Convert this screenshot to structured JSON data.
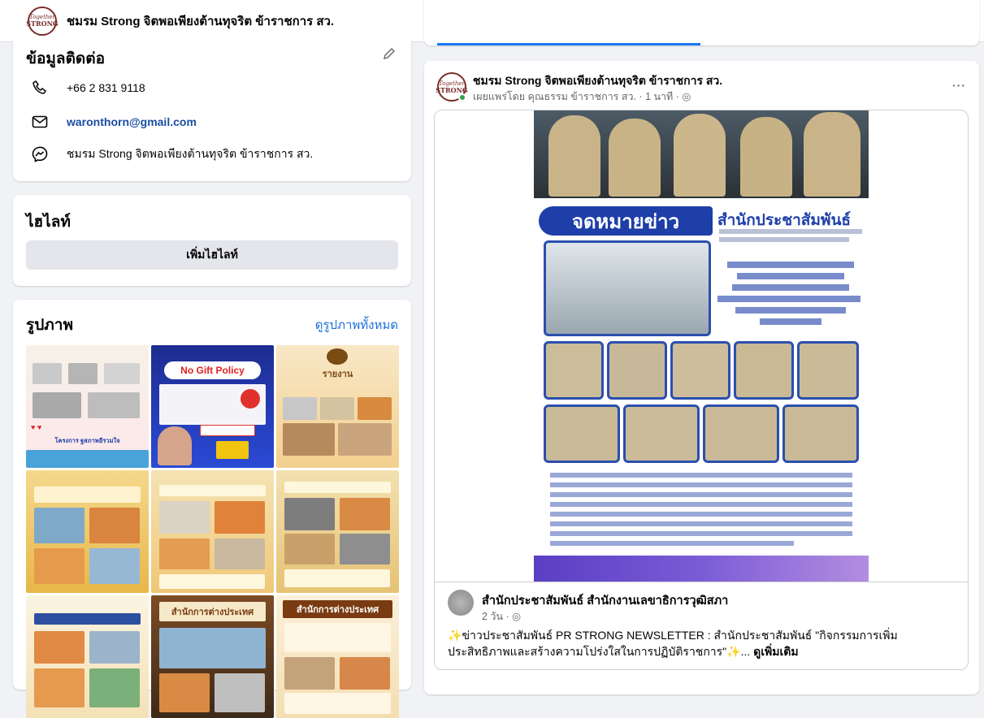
{
  "page": {
    "title": "ชมรม Strong จิตพอเพียงต้านทุจริต ข้าราชการ สว.",
    "logo_line1": "Together",
    "logo_line2": "STRONG",
    "more_icon": "more-horizontal-icon"
  },
  "contact": {
    "heading": "ข้อมูลติดต่อ",
    "phone": "+66 2 831 9118",
    "email": "waronthorn@gmail.com",
    "messenger": "ชมรม Strong จิตพอเพียงต้านทุจริต ข้าราชการ สว."
  },
  "highlights": {
    "heading": "ไฮไลท์",
    "add_button": "เพิ่มไฮไลท์"
  },
  "photos": {
    "heading": "รูปภาพ",
    "see_all": "ดูรูปภาพทั้งหมด",
    "tiles": [
      {
        "caption": "โครงการ ฐสภาพอีรวมใจ"
      },
      {
        "caption": "No Gift Policy"
      },
      {
        "caption": "รายงาน"
      },
      {
        "caption": ""
      },
      {
        "caption": ""
      },
      {
        "caption": ""
      },
      {
        "caption": ""
      },
      {
        "caption": "สำนักการต่างประเทศ"
      },
      {
        "caption": "สำนักการต่างประเทศ"
      }
    ]
  },
  "post": {
    "author": "ชมรม Strong จิตพอเพียงต้านทุจริต ข้าราชการ สว.",
    "meta": "เผยแพร่โดย คุณธรรม ข้าราชการ สว. · 1 นาที ·",
    "image_banner": "จดหมายข่าว",
    "image_org": "สำนักประชาสัมพันธ์",
    "shared": {
      "author": "สำนักประชาสัมพันธ์ สำนักงานเลขาธิการวุฒิสภา",
      "meta": "2 วัน ·",
      "text": "ข่าวประชาสัมพันธ์ PR STRONG NEWSLETTER : สำนักประชาสัมพันธ์ \"กิจกรรมการเพิ่มประสิทธิภาพและสร้างความโปร่งใสในการปฏิบัติราชการ\"",
      "ellipsis": "...",
      "see_more": "ดูเพิ่มเติม"
    }
  },
  "colors": {
    "link": "#1b4ea0",
    "accent": "#1877f2",
    "banner_blue": "#1e3fa8"
  }
}
